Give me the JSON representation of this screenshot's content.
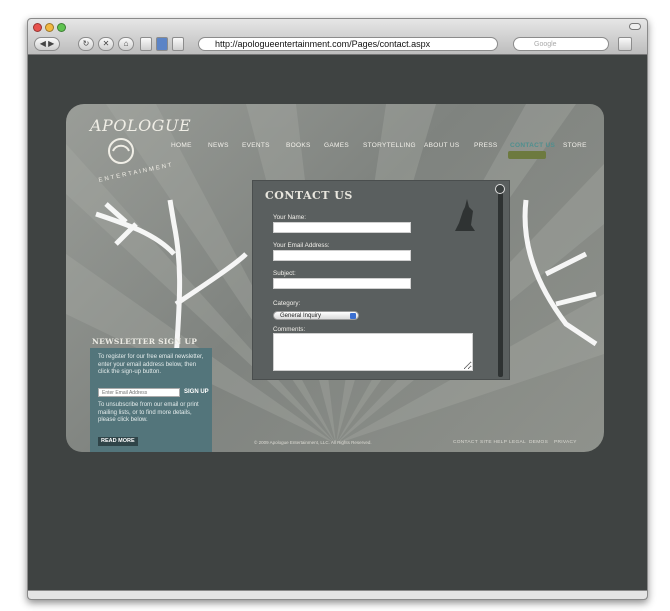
{
  "browser": {
    "url": "http://apologueentertainment.com/Pages/contact.aspx",
    "search_placeholder": "Google"
  },
  "site": {
    "logo_name": "APOLOGUE",
    "logo_sub": "ENTERTAINMENT",
    "nav": [
      "HOME",
      "NEWS",
      "EVENTS",
      "BOOKS",
      "GAMES",
      "STORYTELLING",
      "ABOUT US",
      "PRESS",
      "CONTACT US",
      "STORE"
    ],
    "active_nav": "CONTACT US"
  },
  "contact": {
    "title": "CONTACT US",
    "name_label": "Your Name:",
    "email_label": "Your Email Address:",
    "subject_label": "Subject:",
    "category_label": "Category:",
    "category_value": "General Inquiry",
    "comments_label": "Comments:"
  },
  "newsletter": {
    "title": "NEWSLETTER SIGN UP",
    "intro": "To register for our free email newsletter, enter your email address below, then click the sign-up button.",
    "email_placeholder": "Enter Email Address",
    "signup": "SIGN UP",
    "unsubscribe": "To unsubscribe from our email or print mailing lists, or to find more details, please click below.",
    "read_more": "READ MORE"
  },
  "footer": {
    "copyright": "© 2009 Apologue Entertainment, LLC. All Rights Reserved.",
    "links": [
      "CONTACT",
      "SITE HELP",
      "LEGAL",
      "DEMOS",
      "PRIVACY"
    ]
  },
  "colors": {
    "page_bg": "#3f4342",
    "accent": "#4f8f8f",
    "panel": "#5a5f5f",
    "newsletter": "#53757b"
  }
}
